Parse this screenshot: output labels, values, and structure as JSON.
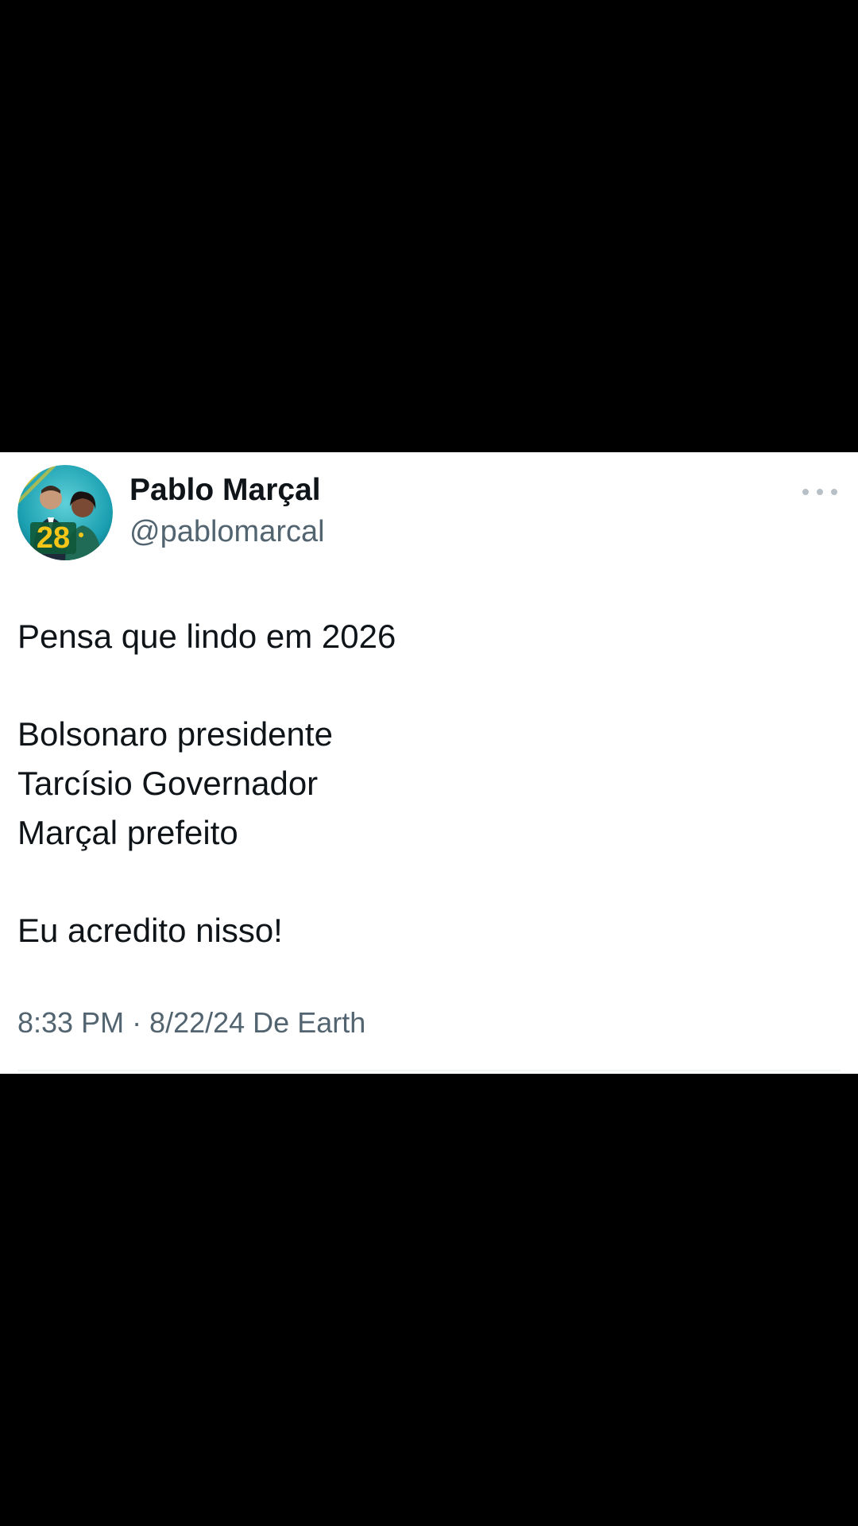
{
  "author": {
    "name": "Pablo Marçal",
    "handle": "@pablomarcal",
    "avatar_badge": "28"
  },
  "tweet": {
    "lines": [
      "Pensa que lindo em 2026",
      "Bolsonaro presidente",
      "Tarcísio Governador",
      "Marçal prefeito",
      "Eu acredito nisso!"
    ],
    "timestamp": "8:33 PM · 8/22/24 De Earth"
  },
  "icons": {
    "more": "more-horizontal-icon"
  },
  "colors": {
    "background": "#000000",
    "card": "#ffffff",
    "text_primary": "#0f1419",
    "text_secondary": "#536471",
    "avatar_ring": "#1a9fb0",
    "badge_yellow": "#f5c518"
  }
}
